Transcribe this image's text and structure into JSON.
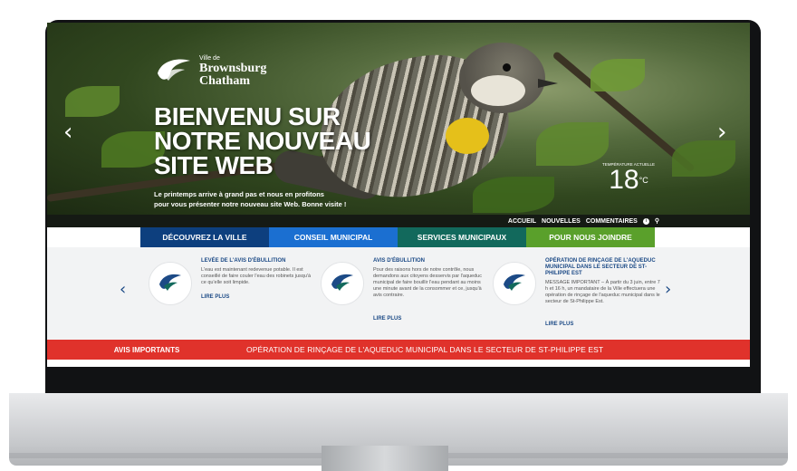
{
  "site": {
    "logo_small": "Ville de",
    "logo_line1": "Brownsburg",
    "logo_line2": "Chatham"
  },
  "hero": {
    "headline_line1": "BIENVENU SUR",
    "headline_line2": "NOTRE NOUVEAU",
    "headline_line3": "SITE WEB",
    "tagline_line1": "Le printemps arrive à grand pas et nous en profitons",
    "tagline_line2": "pour vous présenter notre nouveau site Web. Bonne visite !",
    "prev_arrow": "‹",
    "next_arrow": "›"
  },
  "weather": {
    "label": "TEMPÉRATURE ACTUELLE",
    "temperature": "18",
    "unit": "°C"
  },
  "utility_nav": {
    "items": [
      "ACCUEIL",
      "NOUVELLES",
      "COMMENTAIRES"
    ],
    "info_icon": "i",
    "search_icon": "⚲"
  },
  "main_nav": {
    "items": [
      {
        "label": "DÉCOUVREZ LA VILLE",
        "color": "#0d3f7e"
      },
      {
        "label": "CONSEIL MUNICIPAL",
        "color": "#1b6fd1"
      },
      {
        "label": "SERVICES MUNICIPAUX",
        "color": "#12695c"
      },
      {
        "label": "POUR NOUS JOINDRE",
        "color": "#5aa02b"
      }
    ]
  },
  "news": {
    "prev_arrow": "‹",
    "next_arrow": "›",
    "read_more": "LIRE PLUS",
    "cards": [
      {
        "title": "LEVÉE DE L'AVIS D'ÉBULLITION",
        "text": "L'eau est maintenant redevenue potable. Il est conseillé de faire couler l'eau des robinets jusqu'à ce qu'elle soit limpide."
      },
      {
        "title": "AVIS D'ÉBULLITION",
        "text": "Pour des raisons hors de notre contrôle, nous demandons aux citoyens desservis par l'aqueduc municipal de faire bouillir l'eau pendant au moins une minute avant de la consommer et ce, jusqu'à avis contraire."
      },
      {
        "title": "OPÉRATION DE RINÇAGE DE L'AQUEDUC MUNICIPAL DANS LE SECTEUR DE ST-PHILIPPE EST",
        "text": "MESSAGE IMPORTANT – À partir du 3 juin, entre 7 h et 16 h, un mandataire de la Ville effectuera une opération de rinçage de l'aqueduc municipal dans le secteur de St-Philippe Est."
      }
    ]
  },
  "alert": {
    "label": "AVIS IMPORTANTS",
    "text": "OPÉRATION DE RINÇAGE DE L'AQUEDUC MUNICIPAL DANS LE SECTEUR DE ST-PHILIPPE EST",
    "color": "#e0322b"
  }
}
